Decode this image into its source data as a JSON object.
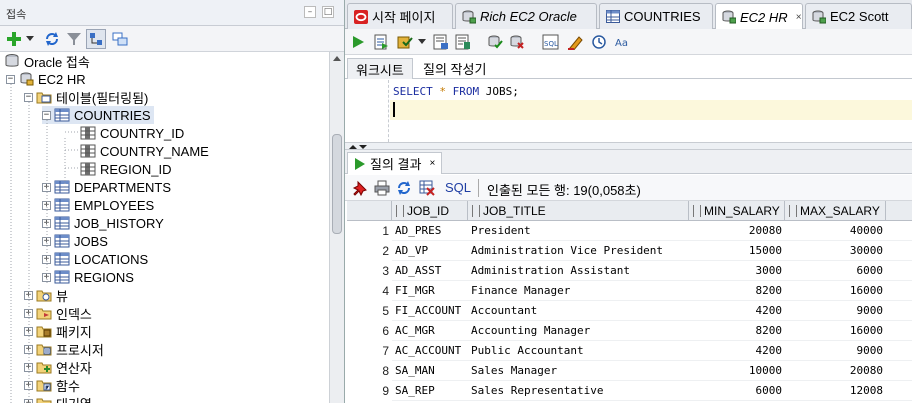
{
  "left_panel": {
    "title": "접속",
    "tree": [
      {
        "label": "Oracle 접속"
      },
      {
        "label": "EC2 HR"
      },
      {
        "label": "테이블(필터링됨)"
      },
      {
        "label": "COUNTRIES"
      },
      {
        "label": "COUNTRY_ID"
      },
      {
        "label": "COUNTRY_NAME"
      },
      {
        "label": "REGION_ID"
      },
      {
        "label": "DEPARTMENTS"
      },
      {
        "label": "EMPLOYEES"
      },
      {
        "label": "JOB_HISTORY"
      },
      {
        "label": "JOBS"
      },
      {
        "label": "LOCATIONS"
      },
      {
        "label": "REGIONS"
      },
      {
        "label": "뷰"
      },
      {
        "label": "인덱스"
      },
      {
        "label": "패키지"
      },
      {
        "label": "프로시저"
      },
      {
        "label": "연산자"
      },
      {
        "label": "함수"
      },
      {
        "label": "대기열"
      }
    ]
  },
  "tabs": [
    {
      "label": "시작 페이지"
    },
    {
      "label": "Rich EC2 Oracle"
    },
    {
      "label": "COUNTRIES"
    },
    {
      "label": "EC2 HR"
    },
    {
      "label": "EC2 Scott"
    }
  ],
  "editor_tabs": {
    "worksheet": "워크시트",
    "query_builder": "질의 작성기"
  },
  "editor": {
    "k1": "SELECT",
    "star": "*",
    "k2": "FROM",
    "rest": "JOBS;"
  },
  "results": {
    "tab_label": "질의 결과",
    "sql_label": "SQL",
    "fetch_info": "인출된 모든 행: 19(0,058초)",
    "columns": [
      "JOB_ID",
      "JOB_TITLE",
      "MIN_SALARY",
      "MAX_SALARY"
    ],
    "rows": [
      {
        "n": "1",
        "job_id": "AD_PRES",
        "title": "President",
        "min": "20080",
        "max": "40000"
      },
      {
        "n": "2",
        "job_id": "AD_VP",
        "title": "Administration Vice President",
        "min": "15000",
        "max": "30000"
      },
      {
        "n": "3",
        "job_id": "AD_ASST",
        "title": "Administration Assistant",
        "min": "3000",
        "max": "6000"
      },
      {
        "n": "4",
        "job_id": "FI_MGR",
        "title": "Finance Manager",
        "min": "8200",
        "max": "16000"
      },
      {
        "n": "5",
        "job_id": "FI_ACCOUNT",
        "title": "Accountant",
        "min": "4200",
        "max": "9000"
      },
      {
        "n": "6",
        "job_id": "AC_MGR",
        "title": "Accounting Manager",
        "min": "8200",
        "max": "16000"
      },
      {
        "n": "7",
        "job_id": "AC_ACCOUNT",
        "title": "Public Accountant",
        "min": "4200",
        "max": "9000"
      },
      {
        "n": "8",
        "job_id": "SA_MAN",
        "title": "Sales Manager",
        "min": "10000",
        "max": "20080"
      },
      {
        "n": "9",
        "job_id": "SA_REP",
        "title": "Sales Representative",
        "min": "6000",
        "max": "12008"
      }
    ]
  },
  "colors": {
    "accent": "#1b2da0",
    "selection": "#dde6f3",
    "current_line": "#fcf8dc"
  }
}
